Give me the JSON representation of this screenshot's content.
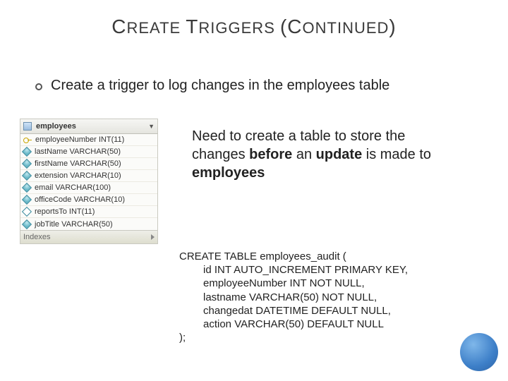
{
  "title": {
    "t1": "C",
    "t2": "REATE ",
    "t3": "T",
    "t4": "RIGGERS ",
    "t5": "(C",
    "t6": "ONTINUED",
    "t7": ")"
  },
  "bullet": "Create a trigger to log changes in the employees table",
  "table": {
    "name": "employees",
    "indexes_label": "Indexes",
    "columns": [
      {
        "icon": "key",
        "label": "employeeNumber INT(11)"
      },
      {
        "icon": "diamond",
        "label": "lastName VARCHAR(50)"
      },
      {
        "icon": "diamond",
        "label": "firstName VARCHAR(50)"
      },
      {
        "icon": "diamond",
        "label": "extension VARCHAR(10)"
      },
      {
        "icon": "diamond",
        "label": "email VARCHAR(100)"
      },
      {
        "icon": "diamond",
        "label": "officeCode VARCHAR(10)"
      },
      {
        "icon": "diamond-hollow",
        "label": "reportsTo INT(11)"
      },
      {
        "icon": "diamond",
        "label": "jobTitle VARCHAR(50)"
      }
    ]
  },
  "explain": {
    "pre1": "Need to create a table to store the changes ",
    "b1": "before",
    "mid1": " an ",
    "b2": "update",
    "mid2": " is made to ",
    "b3": "employees"
  },
  "sql": {
    "l0": "CREATE TABLE employees_audit (",
    "l1": "id INT AUTO_INCREMENT PRIMARY KEY,",
    "l2": "employeeNumber INT NOT NULL,",
    "l3": "lastname VARCHAR(50) NOT NULL,",
    "l4": "changedat DATETIME DEFAULT NULL,",
    "l5": "action VARCHAR(50) DEFAULT NULL",
    "l6": ");"
  }
}
